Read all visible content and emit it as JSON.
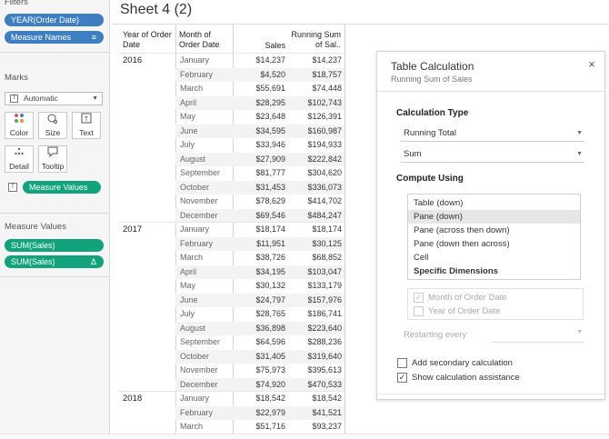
{
  "filters": {
    "title": "Filters",
    "pills": [
      {
        "label": "YEAR(Order Date)"
      },
      {
        "label": "Measure Names",
        "icon": "sort-icon"
      }
    ]
  },
  "marks": {
    "title": "Marks",
    "type_select": "Automatic",
    "buttons": [
      {
        "label": "Color",
        "icon": "color-dots-icon"
      },
      {
        "label": "Size",
        "icon": "size-icon"
      },
      {
        "label": "Text",
        "icon": "text-icon"
      },
      {
        "label": "Detail",
        "icon": "detail-icon"
      },
      {
        "label": "Tooltip",
        "icon": "tooltip-icon"
      }
    ],
    "text_pill": "Measure Values"
  },
  "measure_values": {
    "title": "Measure Values",
    "pills": [
      {
        "label": "SUM(Sales)"
      },
      {
        "label": "SUM(Sales)",
        "icon": "delta-icon",
        "icon_glyph": "Δ"
      }
    ]
  },
  "sheet": {
    "title": "Sheet 4 (2)",
    "headers": {
      "year": "Year of Order Date",
      "month": "Month of Order Date",
      "sales": "Sales",
      "running": "Running Sum of Sal.."
    },
    "years": [
      {
        "year": "2016",
        "rows": [
          [
            "January",
            "$14,237",
            "$14,237"
          ],
          [
            "February",
            "$4,520",
            "$18,757"
          ],
          [
            "March",
            "$55,691",
            "$74,448"
          ],
          [
            "April",
            "$28,295",
            "$102,743"
          ],
          [
            "May",
            "$23,648",
            "$126,391"
          ],
          [
            "June",
            "$34,595",
            "$160,987"
          ],
          [
            "July",
            "$33,946",
            "$194,933"
          ],
          [
            "August",
            "$27,909",
            "$222,842"
          ],
          [
            "September",
            "$81,777",
            "$304,620"
          ],
          [
            "October",
            "$31,453",
            "$336,073"
          ],
          [
            "November",
            "$78,629",
            "$414,702"
          ],
          [
            "December",
            "$69,546",
            "$484,247"
          ]
        ]
      },
      {
        "year": "2017",
        "rows": [
          [
            "January",
            "$18,174",
            "$18,174"
          ],
          [
            "February",
            "$11,951",
            "$30,125"
          ],
          [
            "March",
            "$38,726",
            "$68,852"
          ],
          [
            "April",
            "$34,195",
            "$103,047"
          ],
          [
            "May",
            "$30,132",
            "$133,179"
          ],
          [
            "June",
            "$24,797",
            "$157,976"
          ],
          [
            "July",
            "$28,765",
            "$186,741"
          ],
          [
            "August",
            "$36,898",
            "$223,640"
          ],
          [
            "September",
            "$64,596",
            "$288,236"
          ],
          [
            "October",
            "$31,405",
            "$319,640"
          ],
          [
            "November",
            "$75,973",
            "$395,613"
          ],
          [
            "December",
            "$74,920",
            "$470,533"
          ]
        ]
      },
      {
        "year": "2018",
        "rows": [
          [
            "January",
            "$18,542",
            "$18,542"
          ],
          [
            "February",
            "$22,979",
            "$41,521"
          ],
          [
            "March",
            "$51,716",
            "$93,237"
          ]
        ]
      }
    ]
  },
  "dialog": {
    "title": "Table Calculation",
    "subtitle": "Running Sum of Sales",
    "close_icon": "×",
    "calc_type_heading": "Calculation Type",
    "calc_type": "Running Total",
    "aggregation": "Sum",
    "compute_using_heading": "Compute Using",
    "compute_options": [
      "Table (down)",
      "Pane (down)",
      "Pane (across then down)",
      "Pane (down then across)",
      "Cell",
      "Specific Dimensions"
    ],
    "selected_option": "Pane (down)",
    "dimensions": [
      {
        "label": "Month of Order Date",
        "checked": true
      },
      {
        "label": "Year of Order Date",
        "checked": false
      }
    ],
    "restarting_label": "Restarting every",
    "secondary_label": "Add secondary calculation",
    "secondary_checked": false,
    "assist_label": "Show calculation assistance",
    "assist_checked": true
  },
  "colors": {
    "pill_green": "#11a37b",
    "pill_blue": "#3d7fc1",
    "selection_grey": "#e6e6e6"
  }
}
